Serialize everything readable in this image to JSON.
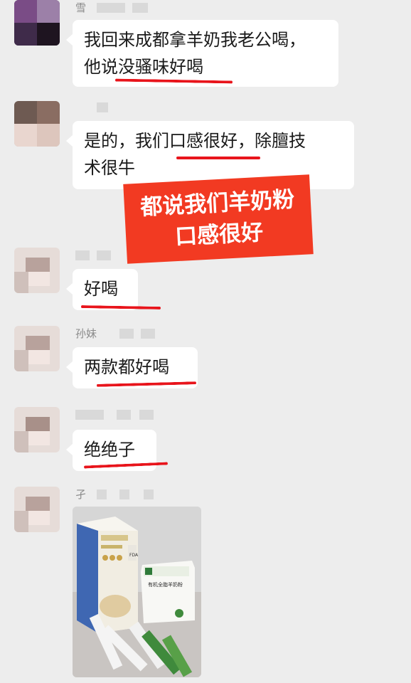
{
  "messages": [
    {
      "sender": "雪",
      "text_lines": [
        "我回来成都拿羊奶我老公喝，",
        "他说没骚味好喝"
      ]
    },
    {
      "sender": "",
      "text_lines": [
        "是的，我们口感很好，除膻技",
        "术很牛"
      ]
    },
    {
      "sender": "",
      "text_lines": [
        "好喝"
      ]
    },
    {
      "sender": "孙妹",
      "text_lines": [
        "两款都好喝"
      ]
    },
    {
      "sender": "",
      "text_lines": [
        "绝绝子"
      ]
    },
    {
      "sender": "孑",
      "image": "product-photo-goat-milk-powder"
    }
  ],
  "banner": {
    "lines": [
      "都说我们羊奶粉",
      "口感很好"
    ]
  },
  "photo": {
    "box_label": "FDA",
    "small_box_text": "有机全脂羊奶粉"
  },
  "colors": {
    "background": "#ededed",
    "bubble": "#ffffff",
    "underline": "#e8141b",
    "banner": "#f23a22"
  }
}
